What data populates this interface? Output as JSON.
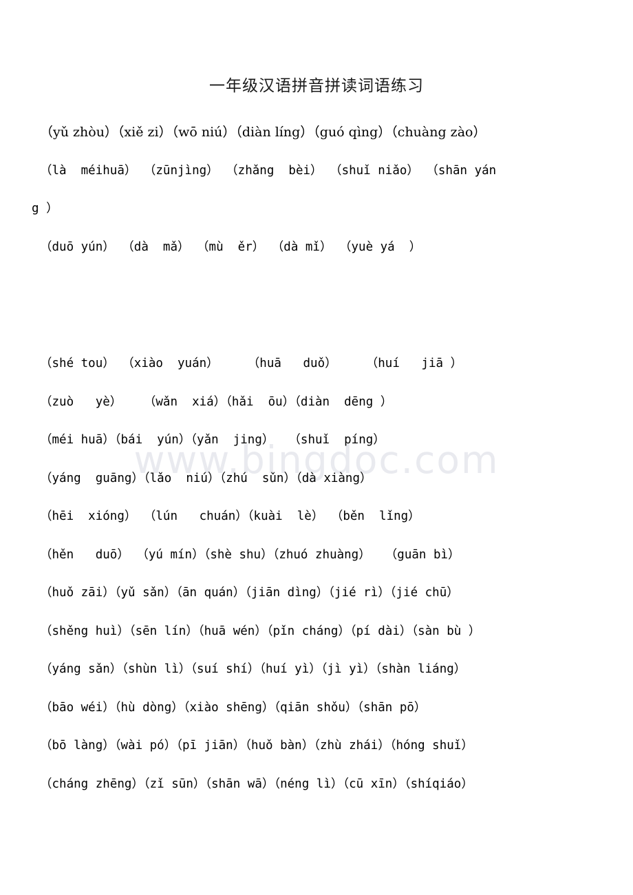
{
  "document": {
    "title": "一年级汉语拼音拼读词语练习",
    "watermark": "www.bingdoc.com"
  },
  "blocks": [
    {
      "id": "block-1",
      "lines": [
        "（yǔ zhòu）（xiě zi）（wō niú）（diàn líng）（guó qìng）（chuàng zào）",
        "（là  méihuā） （zūnjìng） （zhǎng  bèi） （shuǐ niǎo） （shān yán",
        "g ）",
        "（duō yún） （dà  mǎ） （mù  ěr） （dà mǐ） （yuè yá  ）"
      ]
    },
    {
      "id": "block-2",
      "lines": [
        "（shé tou） （xiào  yuán）    （huā   duǒ）    （huí   jiā ）",
        "（zuò   yè）   （wǎn  xiá）（hǎi  ōu）（diàn  dēng ）",
        "（méi huā）（bái  yún）（yǎn  jing）  （shuǐ  píng）",
        "（yáng  guāng）（lǎo  niú）（zhú  sǔn）（dà xiàng）",
        "（hēi  xióng） （lún   chuán）（kuài  lè） （běn  lǐng）",
        "（hěn   duō） （yú mín）（shè shu）（zhuó zhuàng）  （guān bì）",
        "（huǒ zāi）（yǔ sǎn）（ān quán）（jiān dìng）（jié rì）（jié chū）",
        "（shěng huì）（sēn lín）（huā wén）（pǐn cháng）（pí dài）（sàn bù ）",
        "（yáng sǎn）（shùn lì）（suí shí）（huí yì）（jì yì）（shàn liáng）",
        "（bāo wéi）（hù dòng）（xiào shēng）（qiān shǒu）（shān pō）",
        "（bō làng）（wài pó）（pī jiān）（huǒ bàn）（zhù zhái）（hóng shuǐ）",
        "（cháng zhēng）（zǐ sūn）（shān wā）（néng lì）（cū xīn）（shíqiáo）"
      ]
    }
  ]
}
